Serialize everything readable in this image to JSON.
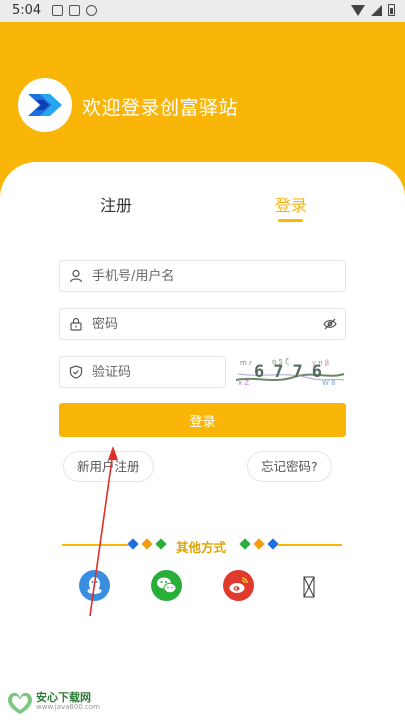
{
  "status_bar": {
    "time": "5:04"
  },
  "header": {
    "title": "欢迎登录创富驿站"
  },
  "tabs": {
    "register": "注册",
    "login": "登录"
  },
  "form": {
    "username_placeholder": "手机号/用户名",
    "password_placeholder": "密码",
    "captcha_placeholder": "验证码",
    "captcha_digits": "6776"
  },
  "buttons": {
    "login": "登录",
    "new_user": "新用户注册",
    "forgot": "忘记密码?"
  },
  "other": {
    "label": "其他方式"
  },
  "social": [
    "qq-icon",
    "wechat-icon",
    "weibo-icon",
    "broken-image-icon"
  ],
  "watermark": {
    "title": "安心下载网",
    "url": "www.java800.com"
  },
  "colors": {
    "accent": "#f9b608",
    "blue": "#1f6fe0",
    "green": "#2aae3a"
  }
}
